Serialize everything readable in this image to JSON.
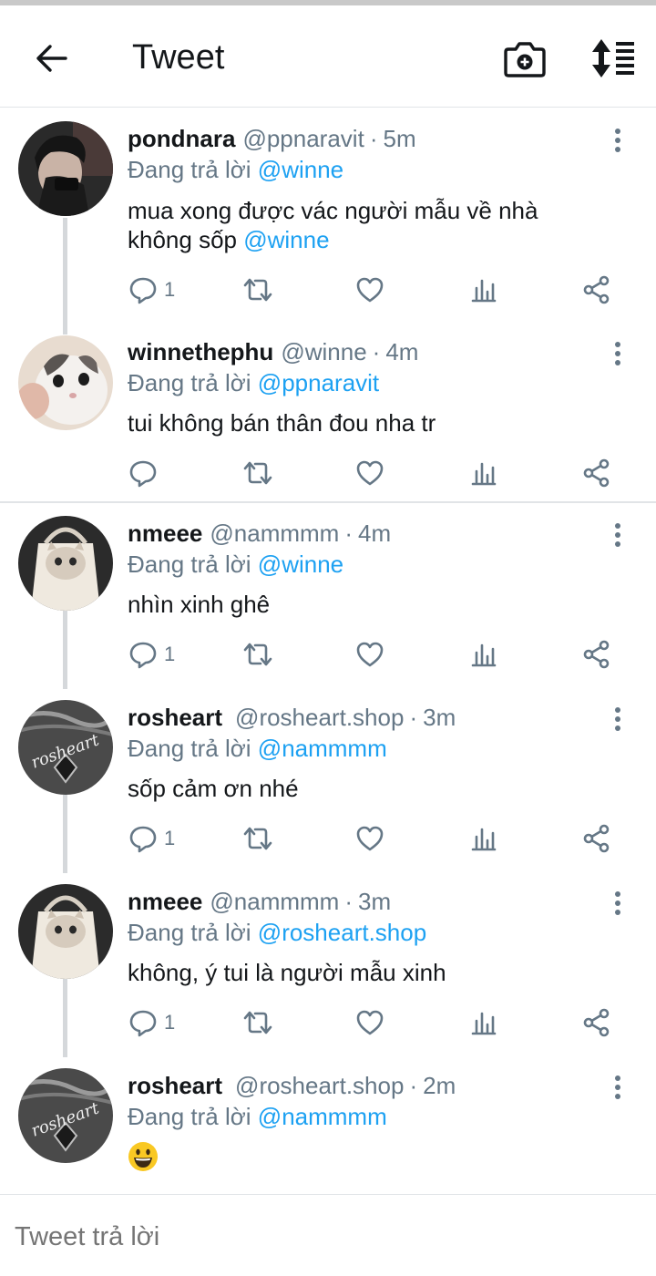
{
  "header": {
    "title": "Tweet"
  },
  "tweets": [
    {
      "name": "pondnara",
      "handle": "@ppnaravit",
      "time": "5m",
      "reply_prefix": "Đang trả lời",
      "reply_to": "@winne",
      "text_line1": "mua xong được vác người mẫu về nhà",
      "text_line2": "không sốp",
      "text_mention": "@winne",
      "reply_count": "1",
      "avatar": "dark-portrait"
    },
    {
      "name": "winnethephu",
      "handle": "@winne",
      "time": "4m",
      "reply_prefix": "Đang trả lời",
      "reply_to": "@ppnaravit",
      "text": "tui không bán thân đou nha tr",
      "reply_count": "",
      "avatar": "white-cat"
    },
    {
      "name": "nmeee",
      "handle": "@nammmm",
      "time": "4m",
      "reply_prefix": "Đang trả lời",
      "reply_to": "@winne",
      "text": "nhìn xinh ghê",
      "reply_count": "1",
      "avatar": "cat-in-bag"
    },
    {
      "name": "rosheart",
      "handle": "@rosheart.shop",
      "time": "3m",
      "reply_prefix": "Đang trả lời",
      "reply_to": "@nammmm",
      "text": "sốp cảm ơn nhé",
      "reply_count": "1",
      "avatar": "rosheart-logo"
    },
    {
      "name": "nmeee",
      "handle": "@nammmm",
      "time": "3m",
      "reply_prefix": "Đang trả lời",
      "reply_to": "@rosheart.shop",
      "text": "không, ý tui là người mẫu xinh",
      "reply_count": "1",
      "avatar": "cat-in-bag"
    },
    {
      "name": "rosheart",
      "handle": "@rosheart.shop",
      "time": "2m",
      "reply_prefix": "Đang trả lời",
      "reply_to": "@nammmm",
      "text": "😃",
      "reply_count": "",
      "avatar": "rosheart-logo"
    }
  ],
  "avatar_text": "rosheart",
  "composer": {
    "placeholder": "Tweet trả lời"
  },
  "colors": {
    "accent": "#1da1f2",
    "muted": "#657786",
    "divider": "#e1e4e7",
    "thread": "#d5d8db"
  },
  "icons": [
    "back-arrow-icon",
    "camera-add-icon",
    "sort-icon",
    "more-vertical-icon",
    "reply-icon",
    "retweet-icon",
    "like-icon",
    "analytics-icon",
    "share-icon"
  ]
}
